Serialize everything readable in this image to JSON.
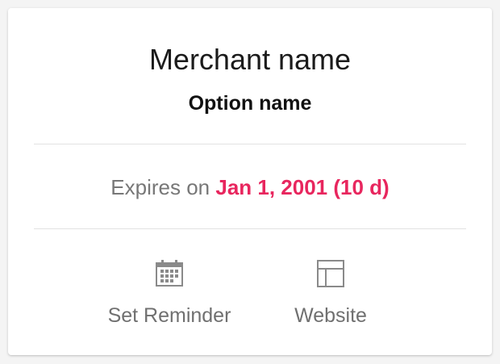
{
  "card": {
    "merchant_name": "Merchant name",
    "option_name": "Option name",
    "expiry": {
      "label": "Expires on",
      "date": "Jan 1, 2001 (10 d)"
    },
    "actions": [
      {
        "label": "Set Reminder",
        "icon": "calendar-icon"
      },
      {
        "label": "Website",
        "icon": "website-icon"
      }
    ]
  },
  "colors": {
    "accent": "#e8265e",
    "muted_text": "#707070",
    "icon": "#8a8a8a",
    "divider": "#e2e2e2"
  }
}
